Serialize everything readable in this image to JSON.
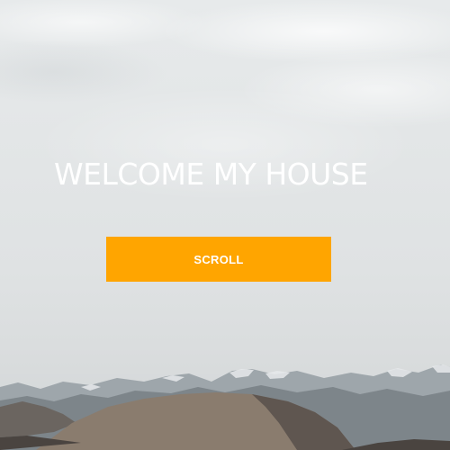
{
  "hero": {
    "title": "WELCOME MY HOUSE",
    "button_label": "SCROLL",
    "background_image": "snowy-mountain-landscape"
  },
  "colors": {
    "accent": "#ffa500",
    "text": "#ffffff",
    "sky": "#e3e6e7"
  }
}
